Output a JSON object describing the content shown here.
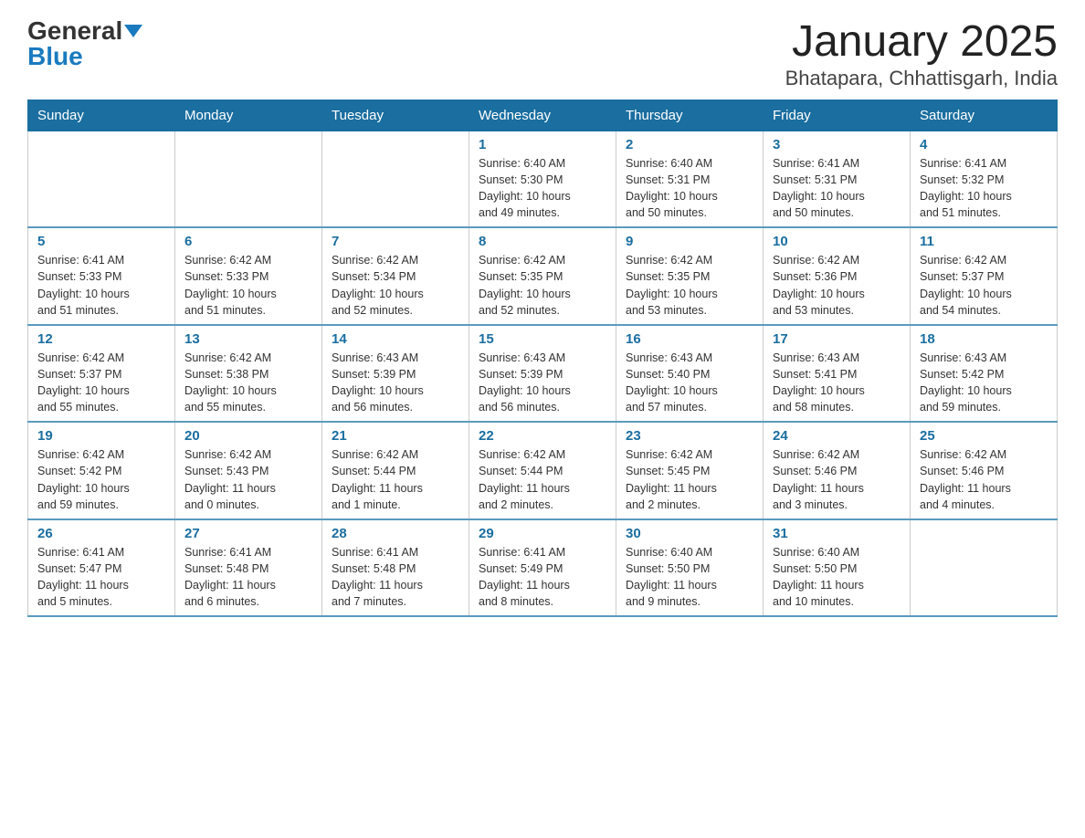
{
  "header": {
    "logo_general": "General",
    "logo_blue": "Blue",
    "month_title": "January 2025",
    "location": "Bhatapara, Chhattisgarh, India"
  },
  "days_of_week": [
    "Sunday",
    "Monday",
    "Tuesday",
    "Wednesday",
    "Thursday",
    "Friday",
    "Saturday"
  ],
  "weeks": [
    [
      {
        "day": "",
        "info": ""
      },
      {
        "day": "",
        "info": ""
      },
      {
        "day": "",
        "info": ""
      },
      {
        "day": "1",
        "info": "Sunrise: 6:40 AM\nSunset: 5:30 PM\nDaylight: 10 hours\nand 49 minutes."
      },
      {
        "day": "2",
        "info": "Sunrise: 6:40 AM\nSunset: 5:31 PM\nDaylight: 10 hours\nand 50 minutes."
      },
      {
        "day": "3",
        "info": "Sunrise: 6:41 AM\nSunset: 5:31 PM\nDaylight: 10 hours\nand 50 minutes."
      },
      {
        "day": "4",
        "info": "Sunrise: 6:41 AM\nSunset: 5:32 PM\nDaylight: 10 hours\nand 51 minutes."
      }
    ],
    [
      {
        "day": "5",
        "info": "Sunrise: 6:41 AM\nSunset: 5:33 PM\nDaylight: 10 hours\nand 51 minutes."
      },
      {
        "day": "6",
        "info": "Sunrise: 6:42 AM\nSunset: 5:33 PM\nDaylight: 10 hours\nand 51 minutes."
      },
      {
        "day": "7",
        "info": "Sunrise: 6:42 AM\nSunset: 5:34 PM\nDaylight: 10 hours\nand 52 minutes."
      },
      {
        "day": "8",
        "info": "Sunrise: 6:42 AM\nSunset: 5:35 PM\nDaylight: 10 hours\nand 52 minutes."
      },
      {
        "day": "9",
        "info": "Sunrise: 6:42 AM\nSunset: 5:35 PM\nDaylight: 10 hours\nand 53 minutes."
      },
      {
        "day": "10",
        "info": "Sunrise: 6:42 AM\nSunset: 5:36 PM\nDaylight: 10 hours\nand 53 minutes."
      },
      {
        "day": "11",
        "info": "Sunrise: 6:42 AM\nSunset: 5:37 PM\nDaylight: 10 hours\nand 54 minutes."
      }
    ],
    [
      {
        "day": "12",
        "info": "Sunrise: 6:42 AM\nSunset: 5:37 PM\nDaylight: 10 hours\nand 55 minutes."
      },
      {
        "day": "13",
        "info": "Sunrise: 6:42 AM\nSunset: 5:38 PM\nDaylight: 10 hours\nand 55 minutes."
      },
      {
        "day": "14",
        "info": "Sunrise: 6:43 AM\nSunset: 5:39 PM\nDaylight: 10 hours\nand 56 minutes."
      },
      {
        "day": "15",
        "info": "Sunrise: 6:43 AM\nSunset: 5:39 PM\nDaylight: 10 hours\nand 56 minutes."
      },
      {
        "day": "16",
        "info": "Sunrise: 6:43 AM\nSunset: 5:40 PM\nDaylight: 10 hours\nand 57 minutes."
      },
      {
        "day": "17",
        "info": "Sunrise: 6:43 AM\nSunset: 5:41 PM\nDaylight: 10 hours\nand 58 minutes."
      },
      {
        "day": "18",
        "info": "Sunrise: 6:43 AM\nSunset: 5:42 PM\nDaylight: 10 hours\nand 59 minutes."
      }
    ],
    [
      {
        "day": "19",
        "info": "Sunrise: 6:42 AM\nSunset: 5:42 PM\nDaylight: 10 hours\nand 59 minutes."
      },
      {
        "day": "20",
        "info": "Sunrise: 6:42 AM\nSunset: 5:43 PM\nDaylight: 11 hours\nand 0 minutes."
      },
      {
        "day": "21",
        "info": "Sunrise: 6:42 AM\nSunset: 5:44 PM\nDaylight: 11 hours\nand 1 minute."
      },
      {
        "day": "22",
        "info": "Sunrise: 6:42 AM\nSunset: 5:44 PM\nDaylight: 11 hours\nand 2 minutes."
      },
      {
        "day": "23",
        "info": "Sunrise: 6:42 AM\nSunset: 5:45 PM\nDaylight: 11 hours\nand 2 minutes."
      },
      {
        "day": "24",
        "info": "Sunrise: 6:42 AM\nSunset: 5:46 PM\nDaylight: 11 hours\nand 3 minutes."
      },
      {
        "day": "25",
        "info": "Sunrise: 6:42 AM\nSunset: 5:46 PM\nDaylight: 11 hours\nand 4 minutes."
      }
    ],
    [
      {
        "day": "26",
        "info": "Sunrise: 6:41 AM\nSunset: 5:47 PM\nDaylight: 11 hours\nand 5 minutes."
      },
      {
        "day": "27",
        "info": "Sunrise: 6:41 AM\nSunset: 5:48 PM\nDaylight: 11 hours\nand 6 minutes."
      },
      {
        "day": "28",
        "info": "Sunrise: 6:41 AM\nSunset: 5:48 PM\nDaylight: 11 hours\nand 7 minutes."
      },
      {
        "day": "29",
        "info": "Sunrise: 6:41 AM\nSunset: 5:49 PM\nDaylight: 11 hours\nand 8 minutes."
      },
      {
        "day": "30",
        "info": "Sunrise: 6:40 AM\nSunset: 5:50 PM\nDaylight: 11 hours\nand 9 minutes."
      },
      {
        "day": "31",
        "info": "Sunrise: 6:40 AM\nSunset: 5:50 PM\nDaylight: 11 hours\nand 10 minutes."
      },
      {
        "day": "",
        "info": ""
      }
    ]
  ]
}
